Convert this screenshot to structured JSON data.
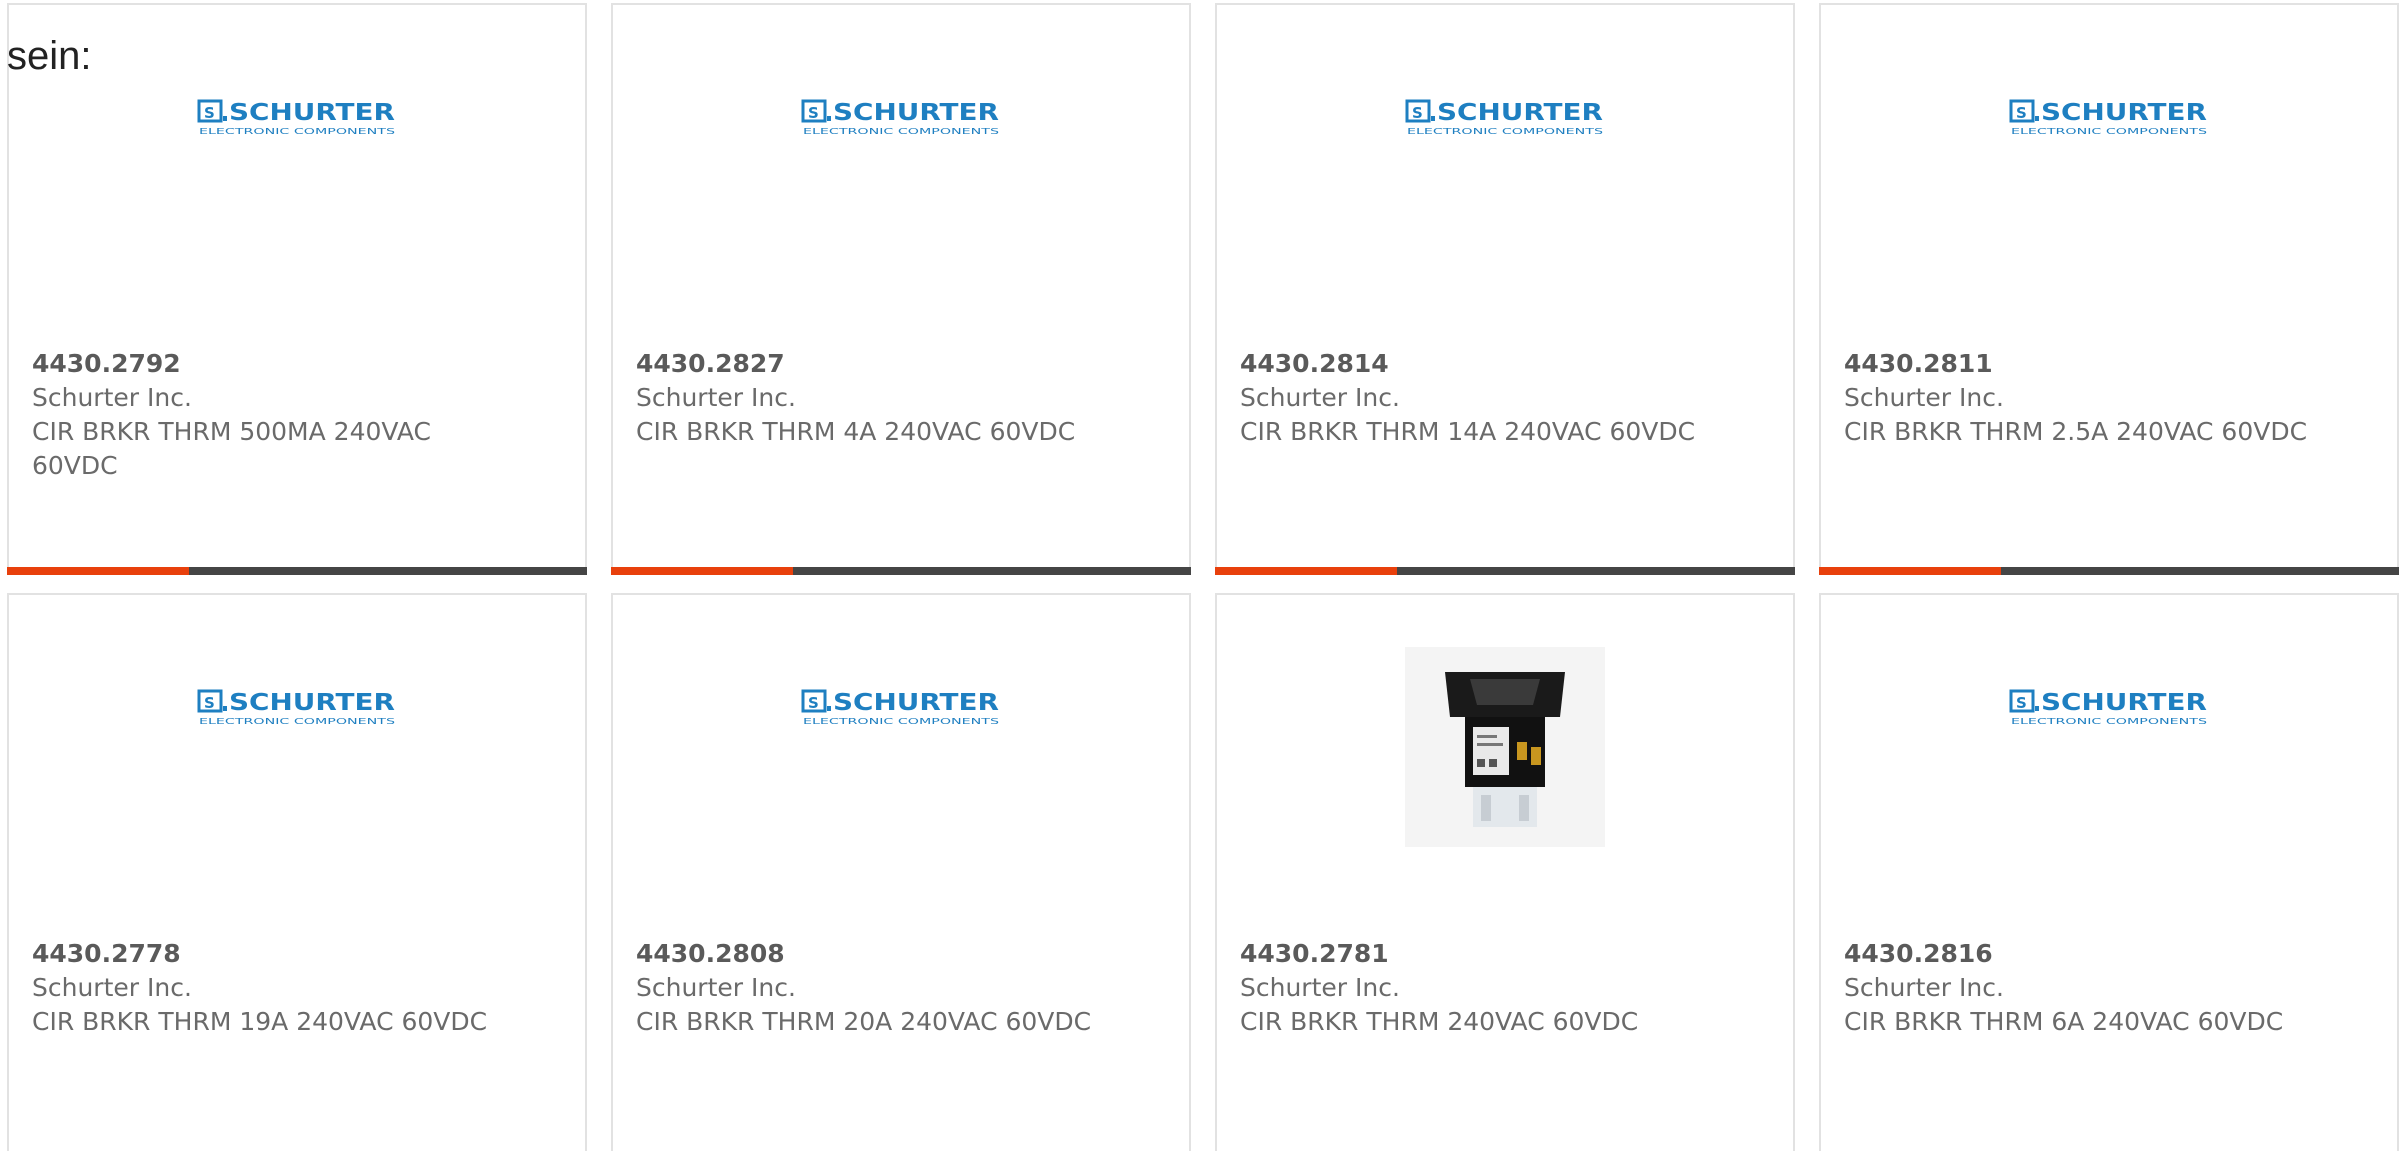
{
  "intro_text": "sein:",
  "colors": {
    "accent": "#e8400c",
    "bar": "#454545",
    "logo_blue": "#1e7fc1"
  },
  "logo": {
    "brand": "SCHURTER",
    "tagline": "ELECTRONIC COMPONENTS"
  },
  "products": [
    {
      "part": "4430.2792",
      "manufacturer": "Schurter Inc.",
      "description": "CIR BRKR THRM 500MA 240VAC 60VDC",
      "image": "schurter-logo",
      "has_bar": true
    },
    {
      "part": "4430.2827",
      "manufacturer": "Schurter Inc.",
      "description": "CIR BRKR THRM 4A 240VAC 60VDC",
      "image": "schurter-logo",
      "has_bar": true
    },
    {
      "part": "4430.2814",
      "manufacturer": "Schurter Inc.",
      "description": "CIR BRKR THRM 14A 240VAC 60VDC",
      "image": "schurter-logo",
      "has_bar": true
    },
    {
      "part": "4430.2811",
      "manufacturer": "Schurter Inc.",
      "description": "CIR BRKR THRM 2.5A 240VAC 60VDC",
      "image": "schurter-logo",
      "has_bar": true
    },
    {
      "part": "4430.2778",
      "manufacturer": "Schurter Inc.",
      "description": "CIR BRKR THRM 19A 240VAC 60VDC",
      "image": "schurter-logo",
      "has_bar": false
    },
    {
      "part": "4430.2808",
      "manufacturer": "Schurter Inc.",
      "description": "CIR BRKR THRM 20A 240VAC 60VDC",
      "image": "schurter-logo",
      "has_bar": false
    },
    {
      "part": "4430.2781",
      "manufacturer": "Schurter Inc.",
      "description": "CIR BRKR THRM 240VAC 60VDC",
      "image": "circuit-breaker-photo",
      "has_bar": false
    },
    {
      "part": "4430.2816",
      "manufacturer": "Schurter Inc.",
      "description": "CIR BRKR THRM 6A 240VAC 60VDC",
      "image": "schurter-logo",
      "has_bar": false
    }
  ]
}
